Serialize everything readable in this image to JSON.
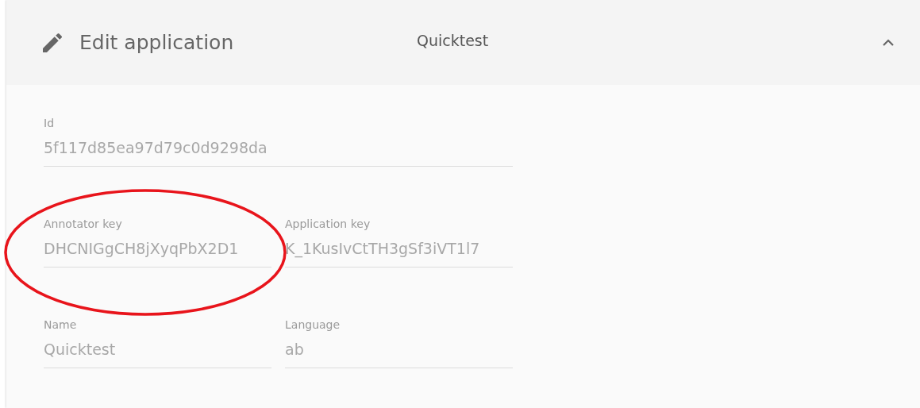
{
  "header": {
    "title": "Edit application",
    "subtitle": "Quicktest",
    "expanded": true
  },
  "rows": [
    [
      {
        "label": "Id",
        "value": "5f117d85ea97d79c0d9298da"
      }
    ],
    [
      {
        "label": "Annotator key",
        "value": "DHCNIGgCH8jXyqPbX2D1"
      },
      {
        "label": "Application key",
        "value": "K_1KusIvCtTH3gSf3iVT1l7"
      }
    ],
    [
      {
        "label": "Name",
        "value": "Quicktest"
      },
      {
        "label": "Language",
        "value": "ab"
      }
    ]
  ]
}
